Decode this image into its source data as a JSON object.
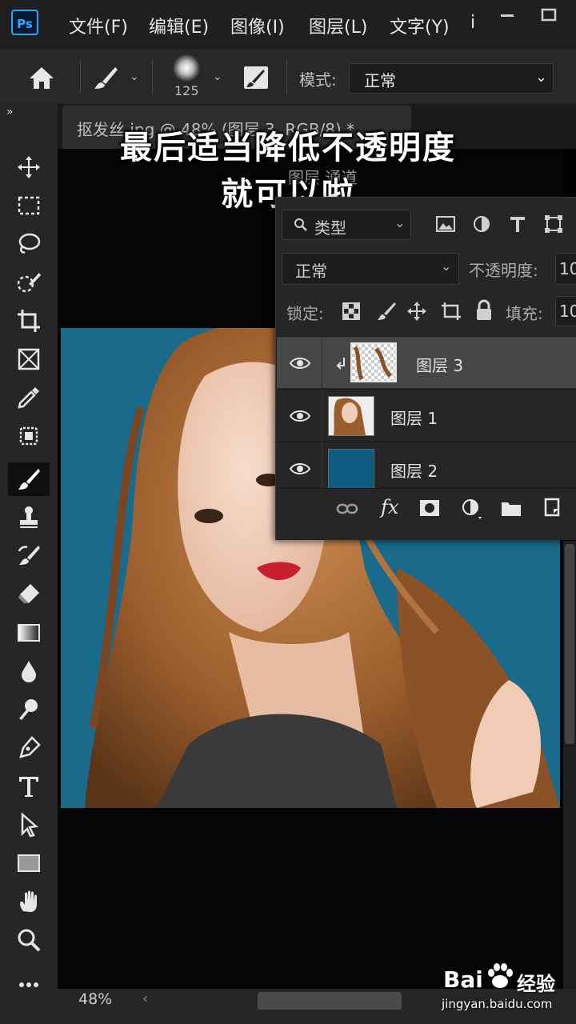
{
  "app": {
    "logo_text": "Ps",
    "accent": "#31a8ff"
  },
  "menu": [
    "文件(F)",
    "编辑(E)",
    "图像(I)",
    "图层(L)",
    "文字(Y)",
    "i"
  ],
  "options_bar": {
    "brush_size": "125",
    "mode_label": "模式:",
    "mode_value": "正常"
  },
  "document_tab": {
    "title": "抠发丝.jpg @ 48% (图层 3, RGB/8) *"
  },
  "panel_tabs_hint": "图层  通道",
  "caption": {
    "line1": "最后适当降低不透明度",
    "line2": "就可以啦"
  },
  "layers_panel": {
    "filter_label": "类型",
    "blend_mode": "正常",
    "opacity_label": "不透明度:",
    "opacity_value": "10",
    "lock_label": "锁定:",
    "fill_label": "填充:",
    "fill_value": "10",
    "layers": [
      {
        "name": "图层 3",
        "selected": true,
        "clipped": true
      },
      {
        "name": "图层 1",
        "selected": false,
        "clipped": false
      },
      {
        "name": "图层 2",
        "selected": false,
        "clipped": false
      }
    ],
    "bottom_fx": "fx"
  },
  "status": {
    "zoom": "48%"
  },
  "watermark": {
    "brand": "Bai",
    "brand2": "经验",
    "url": "jingyan.baidu.com"
  },
  "colors": {
    "canvas_bg": "#1a6a8c",
    "layer2_fill": "#0f5a80",
    "panel_bg": "#262626"
  }
}
